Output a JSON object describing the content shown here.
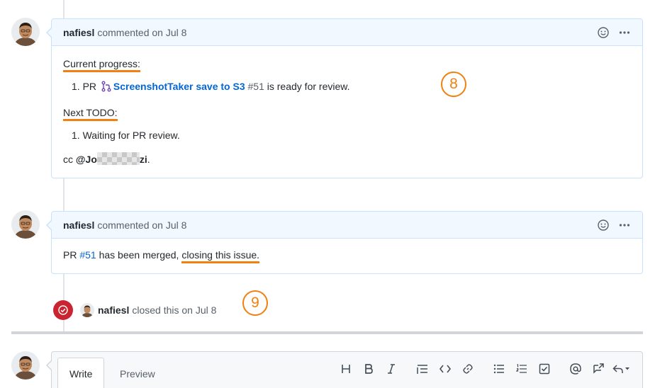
{
  "comments": [
    {
      "author": "nafiesl",
      "meta": "commented on Jul 8",
      "body": {
        "progress_heading": "Current progress:",
        "progress_item_prefix": "1. PR",
        "progress_item_pr_title": "ScreenshotTaker save to S3",
        "progress_item_pr_number": "#51",
        "progress_item_suffix": "is ready for review.",
        "todo_heading": "Next TODO:",
        "todo_item": "1. Waiting for PR review.",
        "cc_prefix": "cc",
        "mention_start": "@Jo",
        "mention_end": "zi",
        "cc_suffix": "."
      }
    },
    {
      "author": "nafiesl",
      "meta": "commented on Jul 8",
      "body": {
        "prefix": "PR",
        "pr_number": "#51",
        "middle": "has been merged,",
        "highlight": "closing this issue."
      }
    }
  ],
  "closed_event": {
    "author": "nafiesl",
    "text": "closed this on Jul 8"
  },
  "annotations": {
    "badge_8": "8",
    "badge_9": "9"
  },
  "editor": {
    "tab_write": "Write",
    "tab_preview": "Preview",
    "toolbar_icons": [
      "heading-icon",
      "bold-icon",
      "italic-icon",
      "quote-icon",
      "code-icon",
      "link-icon",
      "bulleted-list-icon",
      "numbered-list-icon",
      "task-list-icon",
      "mention-icon",
      "cross-reference-icon",
      "reply-icon"
    ]
  },
  "colors": {
    "accent_orange": "#f0800f",
    "link_blue": "#0366d6",
    "closed_red": "#cb2431",
    "header_bg": "#f1f8ff",
    "header_border": "#c8e1ff"
  }
}
